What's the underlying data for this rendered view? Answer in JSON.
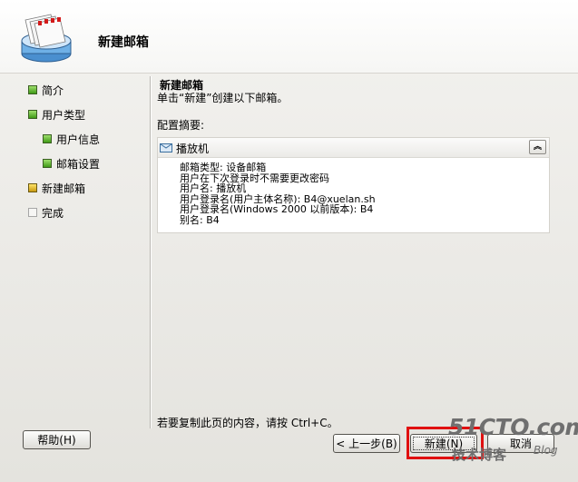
{
  "header": {
    "title": "新建邮箱"
  },
  "sidebar": {
    "items": [
      {
        "label": "简介",
        "status": "completed"
      },
      {
        "label": "用户类型",
        "status": "completed"
      },
      {
        "label": "用户信息",
        "status": "completed"
      },
      {
        "label": "邮箱设置",
        "status": "completed"
      },
      {
        "label": "新建邮箱",
        "status": "current"
      },
      {
        "label": "完成",
        "status": "pending"
      }
    ]
  },
  "main": {
    "title": "新建邮箱",
    "description": "单击“新建”创建以下邮箱。",
    "summary_label": "配置摘要:",
    "summary": {
      "name": "播放机",
      "details": [
        "邮箱类型: 设备邮箱",
        "用户在下次登录时不需要更改密码",
        "用户名: 播放机",
        "用户登录名(用户主体名称): B4@xuelan.sh",
        "用户登录名(Windows 2000 以前版本): B4",
        "别名: B4"
      ]
    },
    "footer_note": "若要复制此页的内容，请按 Ctrl+C。"
  },
  "buttons": {
    "help": "帮助(H)",
    "back": "< 上一步(B)",
    "new": "新建(N)",
    "cancel": "取消"
  },
  "watermark": {
    "main": "51CTO.com",
    "sub": "技术博客",
    "blog": "Blog"
  },
  "colors": {
    "completed": "#3f9a16",
    "current": "#c99a10",
    "highlight": "#e01010"
  }
}
